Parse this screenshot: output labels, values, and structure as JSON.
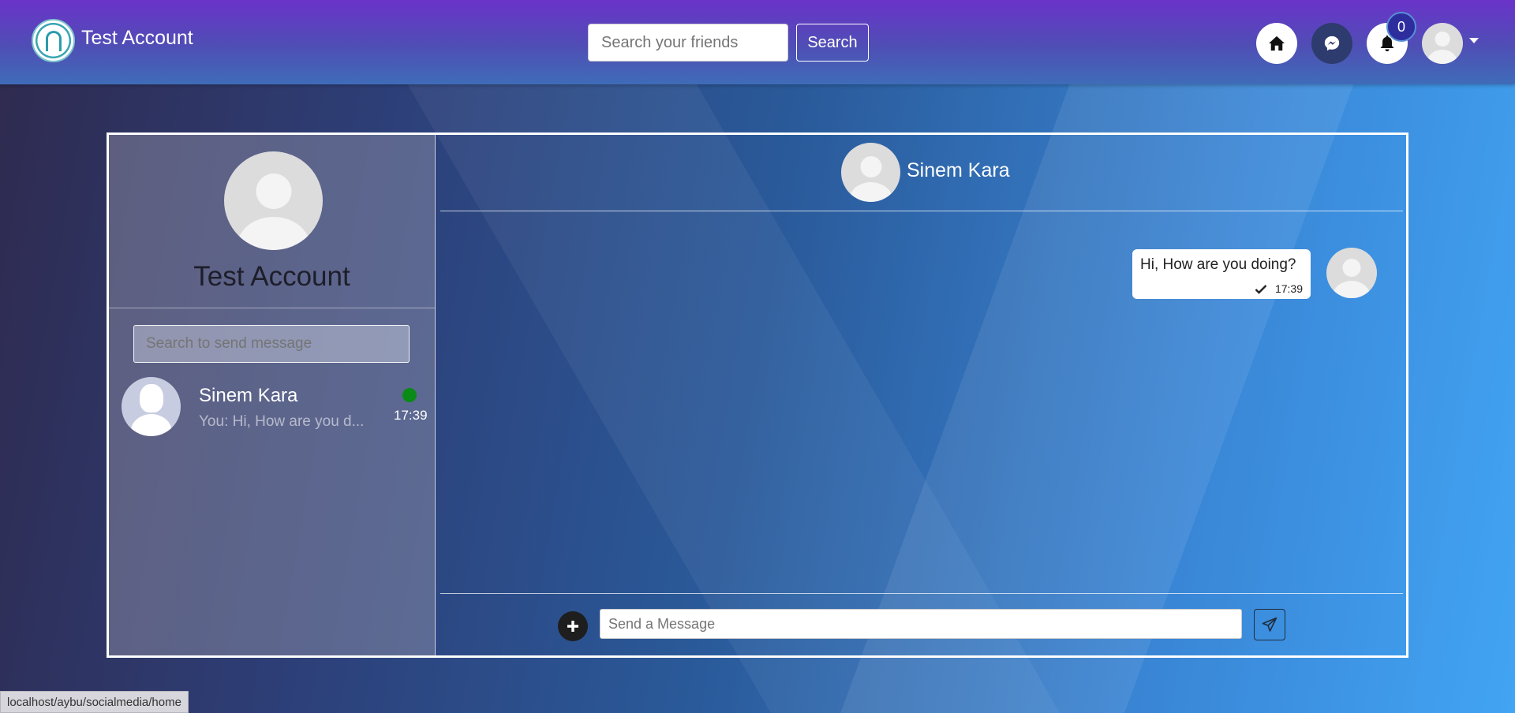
{
  "navbar": {
    "brand_title": "Test Account",
    "logo_icon": "university-logo-icon",
    "search_placeholder": "Search your friends",
    "search_button_label": "Search",
    "icons": [
      "home-icon",
      "messenger-icon",
      "bell-icon",
      "avatar"
    ],
    "notification_count": "0"
  },
  "sidebar": {
    "profile_name": "Test Account",
    "search_placeholder": "Search to send message",
    "contacts": [
      {
        "name": "Sinem Kara",
        "preview": "You: Hi, How are you d...",
        "time": "17:39",
        "online": true
      }
    ]
  },
  "chat": {
    "contact_name": "Sinem Kara",
    "messages": [
      {
        "text": "Hi, How are you doing?",
        "time": "17:39",
        "status": "sent"
      }
    ],
    "input_placeholder": "Send a Message"
  },
  "status_bar": {
    "url": "localhost/aybu/socialmedia/home"
  },
  "colors": {
    "online": "#0a8a16",
    "navbar_top": "#6a33c9",
    "navbar_bottom": "#3f6cb8",
    "badge": "#2d2d9e"
  }
}
